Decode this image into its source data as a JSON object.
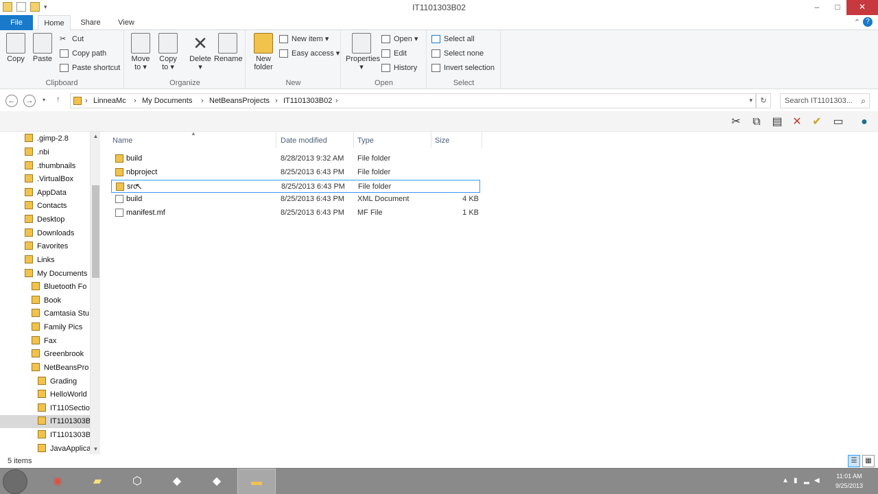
{
  "window": {
    "title": "IT1101303B02",
    "controls": [
      "–",
      "□",
      "✕"
    ]
  },
  "ribbon_tabs": [
    {
      "label": "File"
    },
    {
      "label": "Home"
    },
    {
      "label": "Share"
    },
    {
      "label": "View"
    }
  ],
  "ribbon": {
    "clipboard": {
      "label": "Clipboard",
      "copy": "Copy",
      "paste": "Paste",
      "cut": "Cut",
      "copy_path": "Copy path",
      "paste_shortcut": "Paste shortcut"
    },
    "organize": {
      "label": "Organize",
      "move_to": [
        "Move",
        "to ▾"
      ],
      "copy_to": [
        "Copy",
        "to ▾"
      ],
      "delete": [
        "Delete",
        "▾"
      ],
      "rename": "Rename"
    },
    "new": {
      "label": "New",
      "new_folder": [
        "New",
        "folder"
      ],
      "new_item": "New item ▾",
      "easy_access": "Easy access ▾"
    },
    "open": {
      "label": "Open",
      "properties": [
        "Properties",
        "▾"
      ],
      "open": "Open ▾",
      "edit": "Edit",
      "history": "History"
    },
    "select": {
      "label": "Select",
      "select_all": "Select all",
      "select_none": "Select none",
      "invert_selection": "Invert selection"
    }
  },
  "address": {
    "breadcrumbs": [
      "LinneaMc",
      "My Documents",
      "NetBeansProjects",
      "IT1101303B02"
    ],
    "search_placeholder": "Search IT1101303..."
  },
  "nav_tree": [
    {
      "label": ".gimp-2.8",
      "level": 0
    },
    {
      "label": ".nbi",
      "level": 0
    },
    {
      "label": ".thumbnails",
      "level": 0
    },
    {
      "label": ".VirtualBox",
      "level": 0
    },
    {
      "label": "AppData",
      "level": 0
    },
    {
      "label": "Contacts",
      "level": 0
    },
    {
      "label": "Desktop",
      "level": 0
    },
    {
      "label": "Downloads",
      "level": 0
    },
    {
      "label": "Favorites",
      "level": 0
    },
    {
      "label": "Links",
      "level": 0
    },
    {
      "label": "My Documents",
      "level": 0
    },
    {
      "label": "Bluetooth Fo",
      "level": 1
    },
    {
      "label": "Book",
      "level": 1
    },
    {
      "label": "Camtasia Stu",
      "level": 1
    },
    {
      "label": "Family Pics",
      "level": 1
    },
    {
      "label": "Fax",
      "level": 1
    },
    {
      "label": "Greenbrook",
      "level": 1
    },
    {
      "label": "NetBeansPro",
      "level": 1
    },
    {
      "label": "Grading",
      "level": 2
    },
    {
      "label": "HelloWorld",
      "level": 2
    },
    {
      "label": "IT110Sectio",
      "level": 2
    },
    {
      "label": "IT1101303B",
      "level": 2,
      "selected": true
    },
    {
      "label": "IT1101303B",
      "level": 2
    },
    {
      "label": "JavaApplica",
      "level": 2
    }
  ],
  "columns": {
    "name": "Name",
    "date": "Date modified",
    "type": "Type",
    "size": "Size"
  },
  "files": [
    {
      "name": "build",
      "date": "8/28/2013 9:32 AM",
      "type": "File folder",
      "size": "",
      "icon": "folder-icon"
    },
    {
      "name": "nbproject",
      "date": "8/25/2013 6:43 PM",
      "type": "File folder",
      "size": "",
      "icon": "folder-icon"
    },
    {
      "name": "src",
      "date": "8/25/2013 6:43 PM",
      "type": "File folder",
      "size": "",
      "icon": "folder-icon",
      "selected": true
    },
    {
      "name": "build",
      "date": "8/25/2013 6:43 PM",
      "type": "XML Document",
      "size": "4 KB",
      "icon": "xml-file-icon"
    },
    {
      "name": "manifest.mf",
      "date": "8/25/2013 6:43 PM",
      "type": "MF File",
      "size": "1 KB",
      "icon": "file-icon"
    }
  ],
  "status": {
    "item_count": "5 items"
  },
  "taskbar": {
    "clock_time": "11:01 AM",
    "clock_date": "9/25/2013"
  },
  "colors": {
    "file_tab": "#1979ca",
    "selection_border": "#3399ff",
    "folder": "#f1c24c"
  }
}
